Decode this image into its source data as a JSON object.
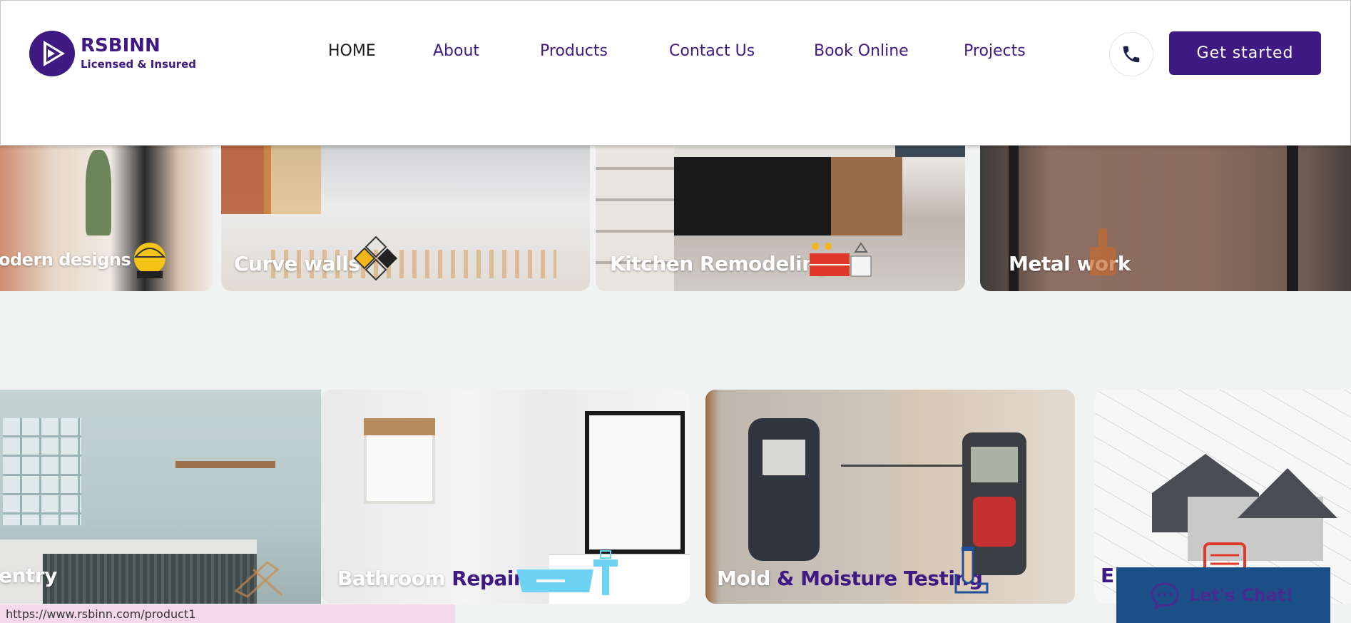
{
  "brand": {
    "name": "RSBINN",
    "tagline": "Licensed & Insured",
    "primary_color": "#3f1a82",
    "logo_icon": "play-triangles-icon"
  },
  "nav": {
    "items": [
      {
        "label": "HOME",
        "active": true
      },
      {
        "label": "About"
      },
      {
        "label": "Products"
      },
      {
        "label": "Contact Us"
      },
      {
        "label": "Book Online"
      },
      {
        "label": "Projects"
      }
    ]
  },
  "header": {
    "phone_icon": "phone-icon",
    "cta_label": "Get started"
  },
  "cards_row1": [
    {
      "label": "odern designs",
      "icon": "worker-helmet-icon"
    },
    {
      "label": "Curve walls",
      "icon": "diamond-tiles-icon"
    },
    {
      "label": "Kitchen Remodeling",
      "icon": "kitchen-stove-icon"
    },
    {
      "label": "Metal work",
      "icon": "paint-brush-icon"
    }
  ],
  "cards_row2": [
    {
      "label": "entry",
      "icon": "carpentry-tools-icon"
    },
    {
      "label_white": "Bathroom ",
      "label_purple": "Repair",
      "icon": "bathtub-sink-icon"
    },
    {
      "label_white": "Mold ",
      "label_purple": "& Moisture Testing",
      "icon": "test-tube-icon"
    },
    {
      "label_purple": "E",
      "icon": "blueprint-icon"
    }
  ],
  "status_bar": {
    "url": "https://www.rsbinn.com/product1"
  },
  "chat": {
    "label": "Let's Chat!",
    "icon": "chat-bubble-icon"
  }
}
